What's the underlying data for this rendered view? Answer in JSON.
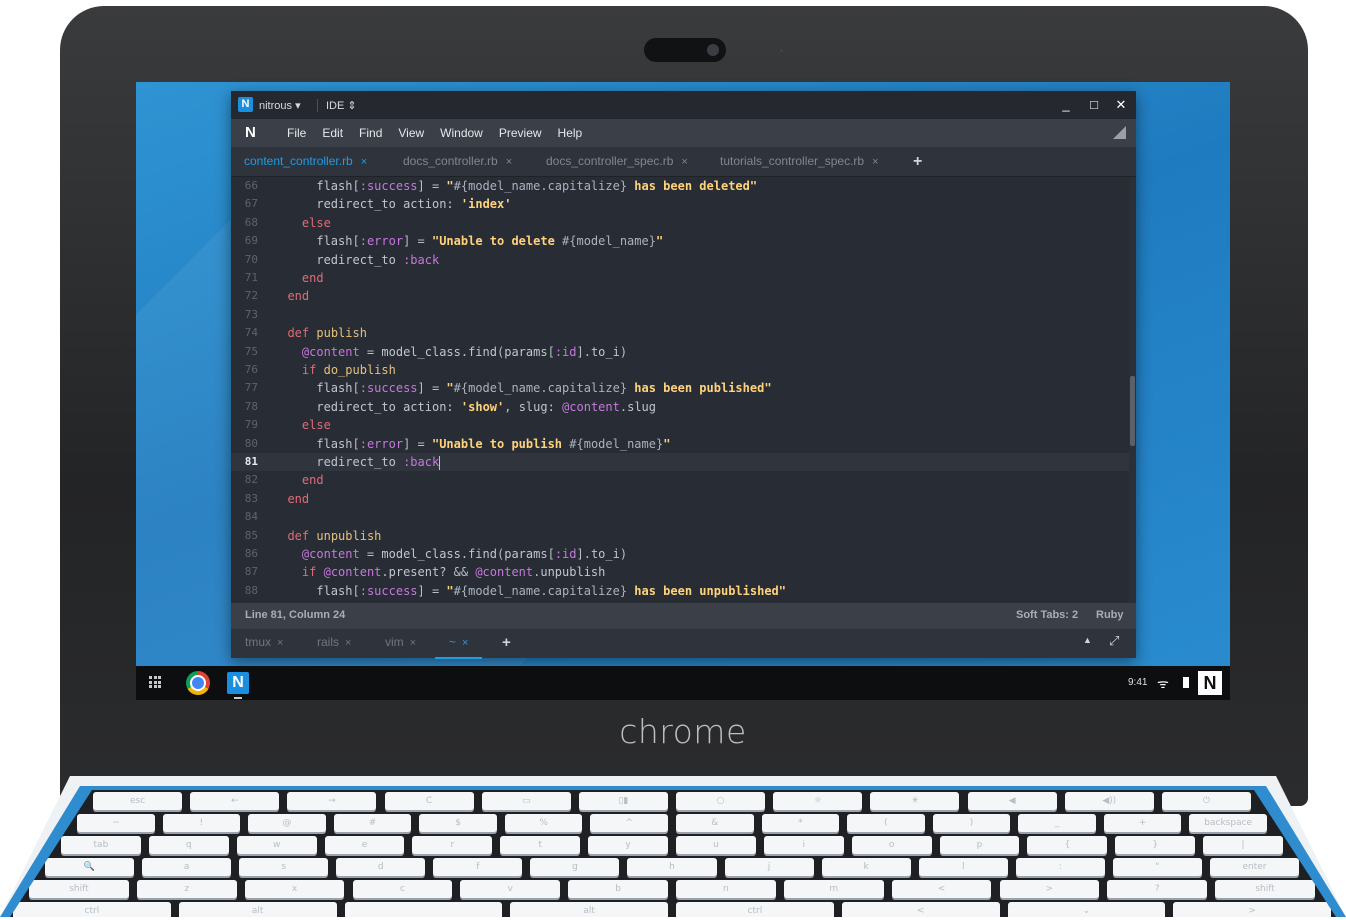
{
  "device": {
    "brand_label": "chrome"
  },
  "ide": {
    "app_name": "nitrous",
    "app_caret": "▾",
    "workspace": "IDE",
    "workspace_caret": "⇕",
    "window_controls": {
      "minimize": "_",
      "maximize": "□",
      "close": "✕"
    },
    "logo_letter": "N",
    "menu": [
      "File",
      "Edit",
      "Find",
      "View",
      "Window",
      "Preview",
      "Help"
    ],
    "tabs": [
      {
        "label": "content_controller.rb",
        "active": true
      },
      {
        "label": "docs_controller.rb",
        "active": false
      },
      {
        "label": "docs_controller_spec.rb",
        "active": false
      },
      {
        "label": "tutorials_controller_spec.rb",
        "active": false
      }
    ],
    "tab_close_glyph": "×",
    "add_glyph": "+",
    "editor": {
      "current_line": 81,
      "lines": [
        {
          "n": "66",
          "html": "      <span class='var'>flash</span>[<span class='sym'>:success</span>] = <span class='str'>\"<span class='interp'>#{model_name.capitalize}</span> has been deleted\"</span>"
        },
        {
          "n": "67",
          "html": "      <span class='var'>redirect_to</span> <span class='var'>action:</span> <span class='str'>'index'</span>"
        },
        {
          "n": "68",
          "html": "    <span class='kw'>else</span>"
        },
        {
          "n": "69",
          "html": "      <span class='var'>flash</span>[<span class='sym'>:error</span>] = <span class='str'>\"Unable to delete <span class='interp'>#{model_name}</span>\"</span>"
        },
        {
          "n": "70",
          "html": "      <span class='var'>redirect_to</span> <span class='sym'>:back</span>"
        },
        {
          "n": "71",
          "html": "    <span class='kw'>end</span>"
        },
        {
          "n": "72",
          "html": "  <span class='kw'>end</span>"
        },
        {
          "n": "73",
          "html": ""
        },
        {
          "n": "74",
          "html": "  <span class='kw'>def</span> <span class='fn'>publish</span>"
        },
        {
          "n": "75",
          "html": "    <span class='sym'>@content</span> = <span class='var'>model_class.find</span>(<span class='var'>params</span>[<span class='sym'>:id</span>].<span class='var'>to_i</span>)"
        },
        {
          "n": "76",
          "html": "    <span class='kw'>if</span> <span class='fn'>do_publish</span>"
        },
        {
          "n": "77",
          "html": "      <span class='var'>flash</span>[<span class='sym'>:success</span>] = <span class='str'>\"<span class='interp'>#{model_name.capitalize}</span> has been published\"</span>"
        },
        {
          "n": "78",
          "html": "      <span class='var'>redirect_to</span> <span class='var'>action:</span> <span class='str'>'show'</span>, <span class='var'>slug:</span> <span class='sym'>@content</span>.<span class='var'>slug</span>"
        },
        {
          "n": "79",
          "html": "    <span class='kw'>else</span>"
        },
        {
          "n": "80",
          "html": "      <span class='var'>flash</span>[<span class='sym'>:error</span>] = <span class='str'>\"Unable to publish <span class='interp'>#{model_name}</span>\"</span>"
        },
        {
          "n": "81",
          "html": "      <span class='var'>redirect_to</span> <span class='sym'>:back</span><span class='caret'></span>"
        },
        {
          "n": "82",
          "html": "    <span class='kw'>end</span>"
        },
        {
          "n": "83",
          "html": "  <span class='kw'>end</span>"
        },
        {
          "n": "84",
          "html": ""
        },
        {
          "n": "85",
          "html": "  <span class='kw'>def</span> <span class='fn'>unpublish</span>"
        },
        {
          "n": "86",
          "html": "    <span class='sym'>@content</span> = <span class='var'>model_class.find</span>(<span class='var'>params</span>[<span class='sym'>:id</span>].<span class='var'>to_i</span>)"
        },
        {
          "n": "87",
          "html": "    <span class='kw'>if</span> <span class='sym'>@content</span>.<span class='var'>present?</span> && <span class='sym'>@content</span>.<span class='var'>unpublish</span>"
        },
        {
          "n": "88",
          "html": "      <span class='var'>flash</span>[<span class='sym'>:success</span>] = <span class='str'>\"<span class='interp'>#{model_name.capitalize}</span> has been unpublished\"</span>"
        }
      ]
    },
    "status": {
      "position": "Line 81, Column 24",
      "soft_tabs": "Soft Tabs: 2",
      "language": "Ruby"
    },
    "terminal_tabs": [
      {
        "label": "tmux",
        "active": false
      },
      {
        "label": "rails",
        "active": false
      },
      {
        "label": "vim",
        "active": false
      },
      {
        "label": "~",
        "active": true
      }
    ],
    "terminal_controls": {
      "collapse": "▲",
      "fullscreen": "⤢"
    }
  },
  "shelf": {
    "clock": "9:41",
    "wifi_glyph": "ᯤ",
    "user_letter": "N",
    "app_letter": "N"
  },
  "keyboard": {
    "rows": [
      [
        "esc",
        "←",
        "→",
        "C",
        "▭",
        "▯▮",
        "○",
        "☼",
        "☀",
        "◀",
        "◀))",
        "⏻"
      ],
      [
        "~",
        "!",
        "@",
        "#",
        "$",
        "%",
        "^",
        "&",
        "*",
        "(",
        ")",
        "_",
        "+",
        "backspace"
      ],
      [
        "tab",
        "q",
        "w",
        "e",
        "r",
        "t",
        "y",
        "u",
        "i",
        "o",
        "p",
        "{",
        "}",
        "|"
      ],
      [
        "🔍",
        "a",
        "s",
        "d",
        "f",
        "g",
        "h",
        "j",
        "k",
        "l",
        ":",
        "\"",
        "enter"
      ],
      [
        "shift",
        "z",
        "x",
        "c",
        "v",
        "b",
        "n",
        "m",
        "<",
        ">",
        "?",
        "shift"
      ],
      [
        "ctrl",
        "alt",
        "",
        "alt",
        "ctrl",
        "<",
        "⌄",
        ">"
      ]
    ]
  },
  "colors": {
    "accent": "#1e9de8",
    "editor_bg": "#282c34",
    "keyword": "#e06c75",
    "string": "#ffd37a",
    "symbol": "#c678dd"
  }
}
